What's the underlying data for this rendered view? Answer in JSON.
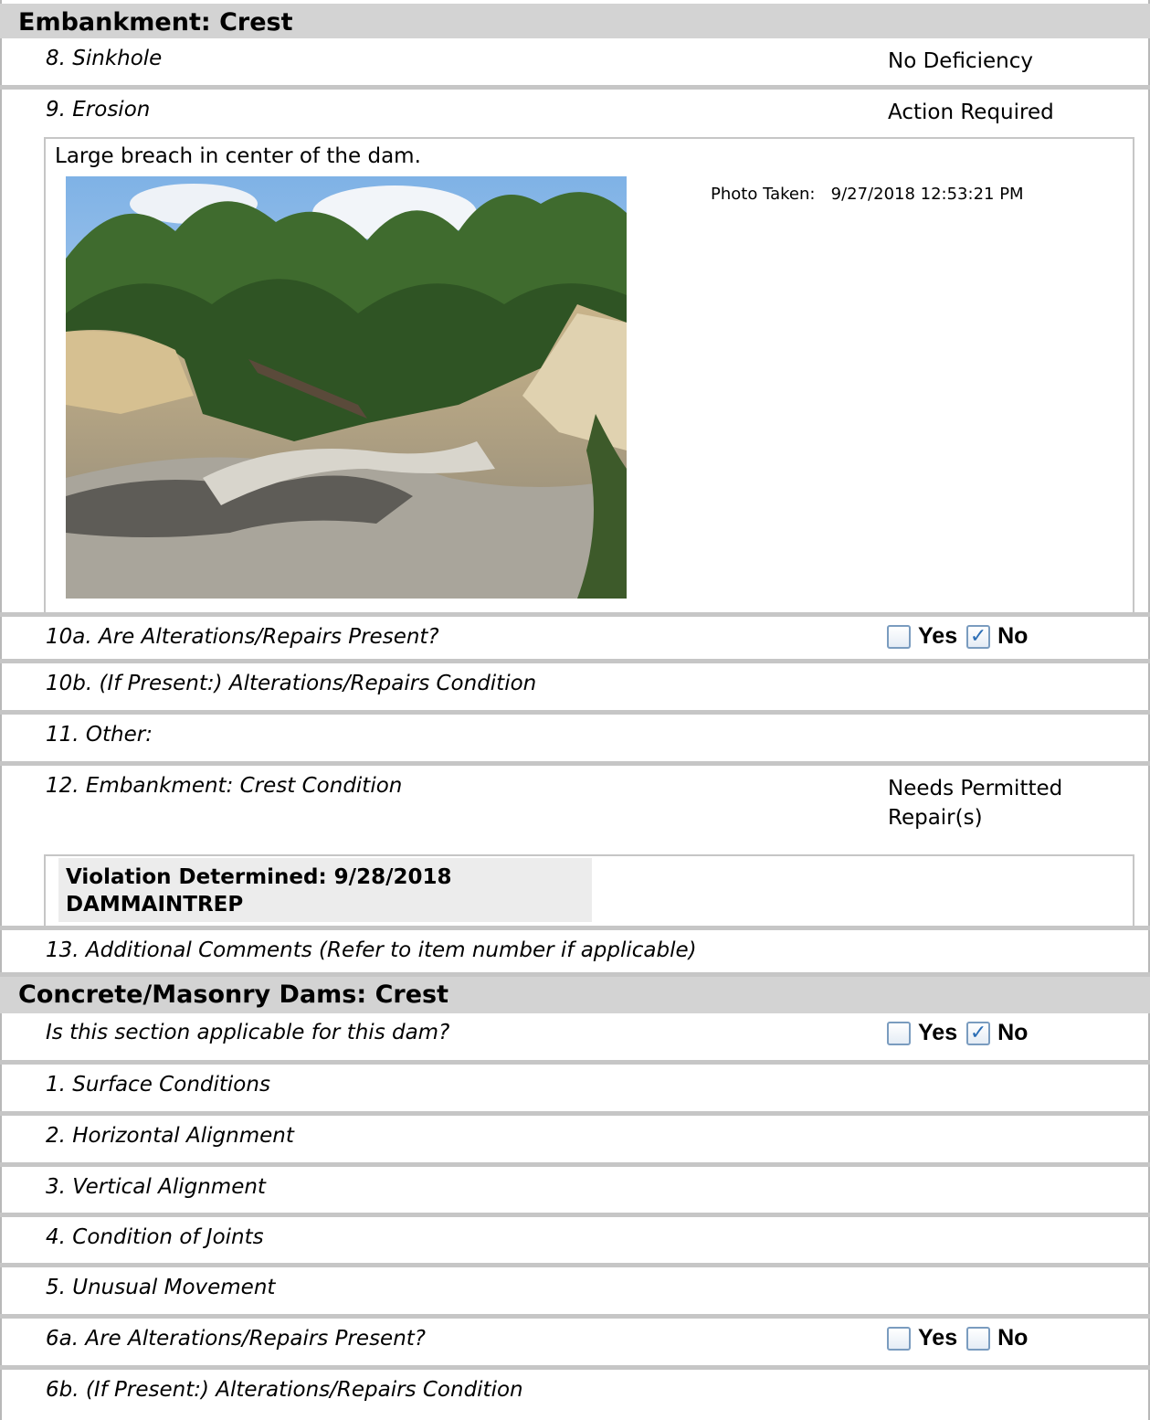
{
  "sections": {
    "embankment_crest": "Embankment: Crest",
    "concrete_crest": "Concrete/Masonry Dams: Crest"
  },
  "rows": {
    "sinkhole": {
      "label": "8. Sinkhole",
      "value": "No Deficiency"
    },
    "erosion": {
      "label": "9. Erosion",
      "value": "Action Required"
    },
    "alt10a": {
      "label": "10a. Are Alterations/Repairs Present?",
      "yes": "Yes",
      "no": "No",
      "yes_checked": false,
      "no_checked": true
    },
    "alt10b": {
      "label": "10b. (If Present:) Alterations/Repairs Condition"
    },
    "other11": {
      "label": "11. Other:"
    },
    "crest12": {
      "label": "12. Embankment: Crest Condition",
      "value_line1": "Needs Permitted",
      "value_line2": "Repair(s)"
    },
    "comments13": {
      "label": "13. Additional Comments (Refer to item number if applicable)"
    },
    "applicable": {
      "label": "Is this section applicable for this dam?",
      "yes": "Yes",
      "no": "No",
      "yes_checked": false,
      "no_checked": true
    },
    "surface": {
      "label": "1. Surface Conditions"
    },
    "horizontal": {
      "label": "2. Horizontal Alignment"
    },
    "vertical": {
      "label": "3. Vertical Alignment"
    },
    "joints": {
      "label": "4. Condition of Joints"
    },
    "movement": {
      "label": "5. Unusual Movement"
    },
    "alt6a": {
      "label": "6a. Are Alterations/Repairs Present?",
      "yes": "Yes",
      "no": "No",
      "yes_checked": false,
      "no_checked": false
    },
    "alt6b": {
      "label": "6b. (If Present:) Alterations/Repairs Condition"
    }
  },
  "erosion_comment": {
    "text": "Large breach in center of the dam.",
    "photo_label": "Photo Taken:",
    "photo_date": "9/27/2018 12:53:21 PM"
  },
  "violation": {
    "line1": "Violation Determined: 9/28/2018",
    "line2": "DAMMAINTREP"
  },
  "colors": {
    "section_header_bg": "#d3d3d3",
    "row_divider": "#c6c6c6",
    "checkbox_border": "#7a9cbf",
    "check_mark": "#2a6db5"
  }
}
